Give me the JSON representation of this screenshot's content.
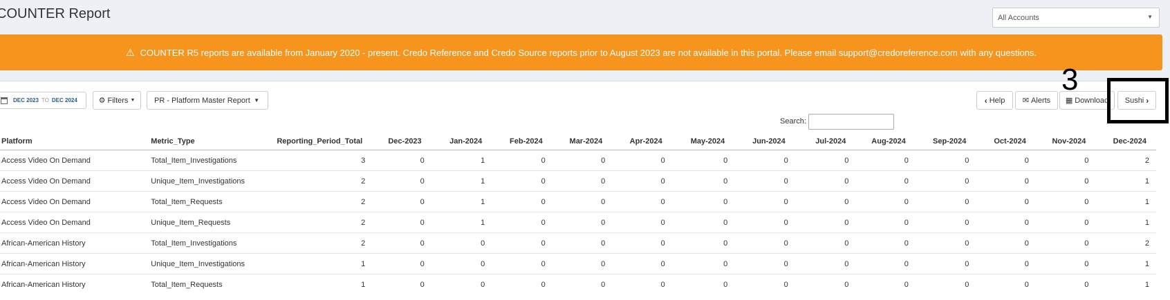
{
  "header": {
    "title": "COUNTER Report",
    "account_select": "All Accounts"
  },
  "banner": {
    "text": "COUNTER R5 reports are available from January 2020 - present. Credo Reference and Credo Source reports prior to August 2023 are not available in this portal. Please email support@credoreference.com with any questions."
  },
  "toolbar": {
    "date_from": "DEC 2023",
    "date_to_label": "TO",
    "date_to": "DEC 2024",
    "filters_label": "Filters",
    "report_select": "PR - Platform Master Report",
    "help_label": "Help",
    "alerts_label": "Alerts",
    "download_label": "Download",
    "sushi_label": "Sushi"
  },
  "search": {
    "label": "Search:"
  },
  "annotation": {
    "number": "3"
  },
  "table": {
    "columns": [
      "Platform",
      "Metric_Type",
      "Reporting_Period_Total",
      "Dec-2023",
      "Jan-2024",
      "Feb-2024",
      "Mar-2024",
      "Apr-2024",
      "May-2024",
      "Jun-2024",
      "Jul-2024",
      "Aug-2024",
      "Sep-2024",
      "Oct-2024",
      "Nov-2024",
      "Dec-2024"
    ],
    "rows": [
      [
        "Access Video On Demand",
        "Total_Item_Investigations",
        "3",
        "0",
        "1",
        "0",
        "0",
        "0",
        "0",
        "0",
        "0",
        "0",
        "0",
        "0",
        "0",
        "2"
      ],
      [
        "Access Video On Demand",
        "Unique_Item_Investigations",
        "2",
        "0",
        "1",
        "0",
        "0",
        "0",
        "0",
        "0",
        "0",
        "0",
        "0",
        "0",
        "0",
        "1"
      ],
      [
        "Access Video On Demand",
        "Total_Item_Requests",
        "2",
        "0",
        "1",
        "0",
        "0",
        "0",
        "0",
        "0",
        "0",
        "0",
        "0",
        "0",
        "0",
        "1"
      ],
      [
        "Access Video On Demand",
        "Unique_Item_Requests",
        "2",
        "0",
        "1",
        "0",
        "0",
        "0",
        "0",
        "0",
        "0",
        "0",
        "0",
        "0",
        "0",
        "1"
      ],
      [
        "African-American History",
        "Total_Item_Investigations",
        "2",
        "0",
        "0",
        "0",
        "0",
        "0",
        "0",
        "0",
        "0",
        "0",
        "0",
        "0",
        "0",
        "2"
      ],
      [
        "African-American History",
        "Unique_Item_Investigations",
        "1",
        "0",
        "0",
        "0",
        "0",
        "0",
        "0",
        "0",
        "0",
        "0",
        "0",
        "0",
        "0",
        "1"
      ],
      [
        "African-American History",
        "Total_Item_Requests",
        "1",
        "0",
        "0",
        "0",
        "0",
        "0",
        "0",
        "0",
        "0",
        "0",
        "0",
        "0",
        "0",
        "1"
      ]
    ]
  }
}
